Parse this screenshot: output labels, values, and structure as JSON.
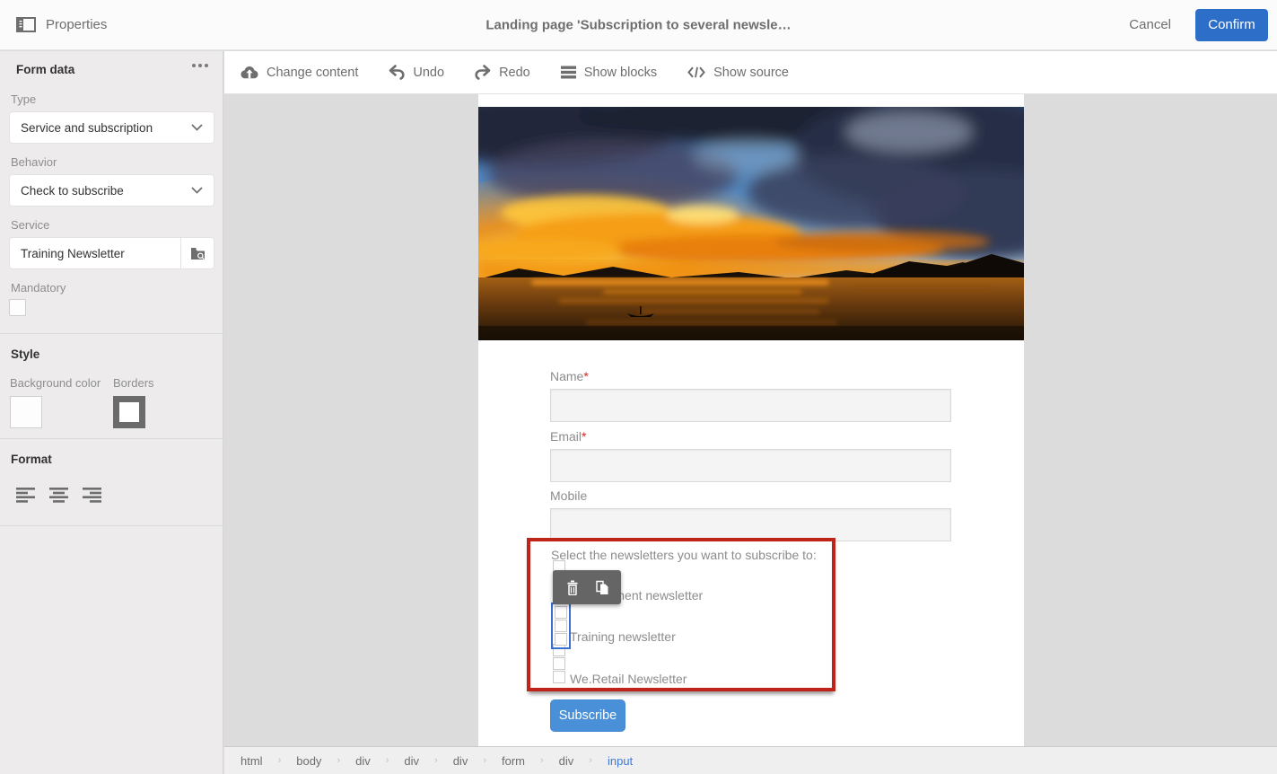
{
  "header": {
    "app_title": "Properties",
    "page_title": "Landing page 'Subscription to several newsle…",
    "cancel_label": "Cancel",
    "confirm_label": "Confirm"
  },
  "editor_toolbar": {
    "items": [
      {
        "label": "Change content",
        "icon": "cloud-upload-icon"
      },
      {
        "label": "Undo",
        "icon": "undo-icon"
      },
      {
        "label": "Redo",
        "icon": "redo-icon"
      },
      {
        "label": "Show blocks",
        "icon": "blocks-icon"
      },
      {
        "label": "Show source",
        "icon": "code-icon"
      }
    ]
  },
  "sidebar": {
    "title": "Form data",
    "type_label": "Type",
    "type_value": "Service and subscription",
    "behavior_label": "Behavior",
    "behavior_value": "Check to subscribe",
    "service_label": "Service",
    "service_value": "Training Newsletter",
    "service_picker_icon": "folder-search-icon",
    "mandatory_label": "Mandatory",
    "mandatory_checked": false,
    "style_title": "Style",
    "background_color_label": "Background color",
    "borders_label": "Borders",
    "format_title": "Format",
    "format_options": [
      "align-left",
      "align-center",
      "align-right"
    ]
  },
  "canvas": {
    "form": {
      "fields": [
        {
          "label": "Name",
          "star": "*",
          "value": ""
        },
        {
          "label": "Email",
          "star": "*",
          "value": ""
        },
        {
          "label": "Mobile",
          "star": "",
          "value": ""
        }
      ],
      "newsletter_prompt": "Select the newsletters you want to subscribe to:",
      "newsletters": [
        "Development newsletter",
        "Training newsletter",
        "We.Retail Newsletter"
      ],
      "submit_label": "Subscribe"
    },
    "floating_toolbar_icons": [
      "trash-icon",
      "copy-icon"
    ]
  },
  "breadcrumb": {
    "items": [
      "html",
      "body",
      "div",
      "div",
      "div",
      "form",
      "div",
      "input"
    ],
    "active": "input"
  },
  "colors": {
    "confirm_blue": "#2d6ec8",
    "subscribe_blue": "#4a90d9",
    "selection_red": "#bf2418",
    "selection_blue": "#3a70d2",
    "breadcrumb_active_blue": "#4079d8",
    "sidebar_bg": "#edebeb",
    "content_bg": "#dcdcdc",
    "required_red": "#e0251b"
  }
}
